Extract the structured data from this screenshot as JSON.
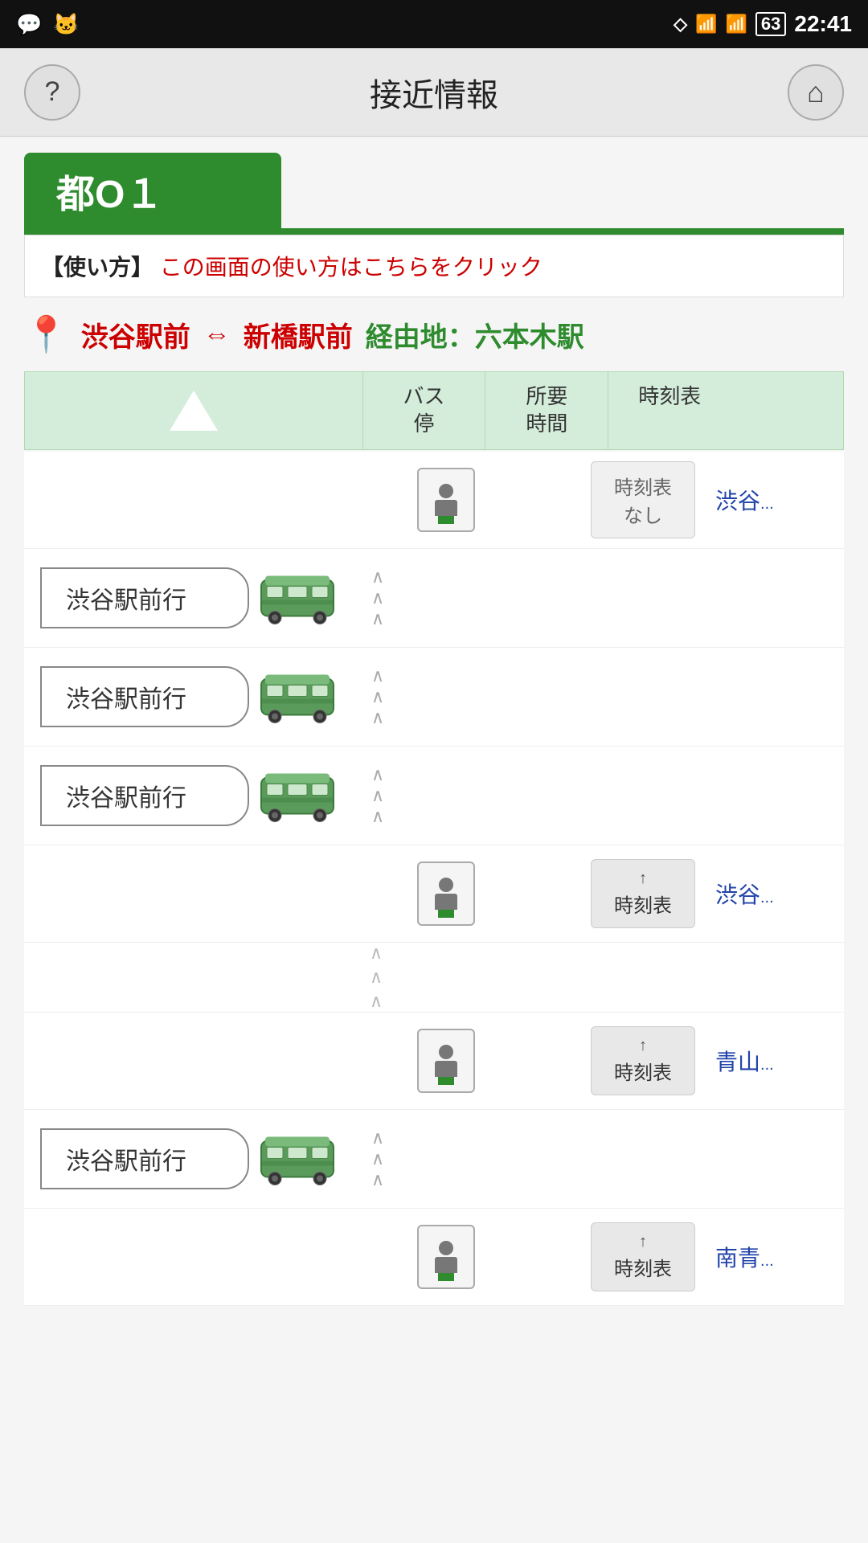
{
  "statusBar": {
    "time": "22:41",
    "batteryLevel": "63"
  },
  "header": {
    "title": "接近情報",
    "helpLabel": "?",
    "homeLabel": "⌂"
  },
  "routeTab": {
    "label": "都O１"
  },
  "usageBar": {
    "prefix": "【使い方】",
    "link": "この画面の使い方はこちらをクリック"
  },
  "routeInfo": {
    "from": "渋谷駅前",
    "arrow": "⇔",
    "to": "新橋駅前",
    "via_label": "経由地：",
    "via_stop": "六本木駅"
  },
  "tableHeader": {
    "col1": "バス\n停",
    "col2": "所要\n時間",
    "col3": "時刻表"
  },
  "stops": [
    {
      "id": "stop1",
      "hasStopIcon": true,
      "timetable": "時刻表\nなし",
      "timetableActive": false,
      "stopName": "渋谷",
      "stopNameFull": "渋谷駅前"
    },
    {
      "id": "stop2",
      "hasStopIcon": true,
      "timetable": "時刻表",
      "timetableActive": true,
      "stopName": "渋谷",
      "stopNameFull": "渋谷駅前"
    },
    {
      "id": "stop3",
      "hasStopIcon": true,
      "timetable": "時刻表",
      "timetableActive": true,
      "stopName": "青山",
      "stopNameFull": "青山一丁目"
    },
    {
      "id": "stop4",
      "hasStopIcon": true,
      "timetable": "時刻表",
      "timetableActive": true,
      "stopName": "南青",
      "stopNameFull": "南青山"
    }
  ],
  "buses": [
    {
      "id": "bus1",
      "destination": "渋谷駅前行",
      "stopIndex": 0
    },
    {
      "id": "bus2",
      "destination": "渋谷駅前行",
      "stopIndex": 0
    },
    {
      "id": "bus3",
      "destination": "渋谷駅前行",
      "stopIndex": 1
    },
    {
      "id": "bus4",
      "destination": "渋谷駅前行",
      "stopIndex": 2
    }
  ]
}
